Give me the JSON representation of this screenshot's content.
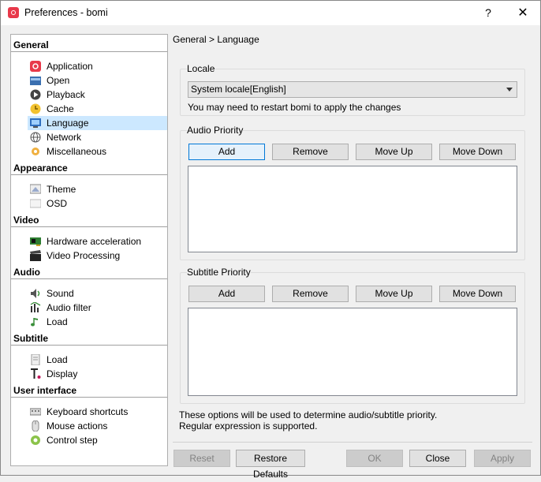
{
  "window": {
    "title": "Preferences - bomi",
    "help_glyph": "?",
    "close_glyph": "✕"
  },
  "sidebar": {
    "categories": [
      {
        "label": "General",
        "items": [
          "Application",
          "Open",
          "Playback",
          "Cache",
          "Language",
          "Network",
          "Miscellaneous"
        ]
      },
      {
        "label": "Appearance",
        "items": [
          "Theme",
          "OSD"
        ]
      },
      {
        "label": "Video",
        "items": [
          "Hardware acceleration",
          "Video Processing"
        ]
      },
      {
        "label": "Audio",
        "items": [
          "Sound",
          "Audio filter",
          "Load"
        ]
      },
      {
        "label": "Subtitle",
        "items": [
          "Load",
          "Display"
        ]
      },
      {
        "label": "User interface",
        "items": [
          "Keyboard shortcuts",
          "Mouse actions",
          "Control step"
        ]
      }
    ],
    "selected": "Language"
  },
  "main": {
    "breadcrumb": "General > Language",
    "locale": {
      "title": "Locale",
      "selected": "System locale[English]",
      "note": "You may need to restart bomi to apply the changes"
    },
    "audio_priority": {
      "title": "Audio Priority",
      "buttons": {
        "add": "Add",
        "remove": "Remove",
        "move_up": "Move Up",
        "move_down": "Move Down"
      }
    },
    "subtitle_priority": {
      "title": "Subtitle Priority",
      "buttons": {
        "add": "Add",
        "remove": "Remove",
        "move_up": "Move Up",
        "move_down": "Move Down"
      }
    },
    "info_line1": "These options will be used to determine audio/subtitle priority.",
    "info_line2": "Regular expression is supported."
  },
  "footer": {
    "reset": "Reset",
    "restore_defaults": "Restore Defaults",
    "ok": "OK",
    "close": "Close",
    "apply": "Apply"
  },
  "colors": {
    "accent": "#0078d7",
    "selection": "#cce8ff",
    "app_icon": "#e8394a"
  }
}
